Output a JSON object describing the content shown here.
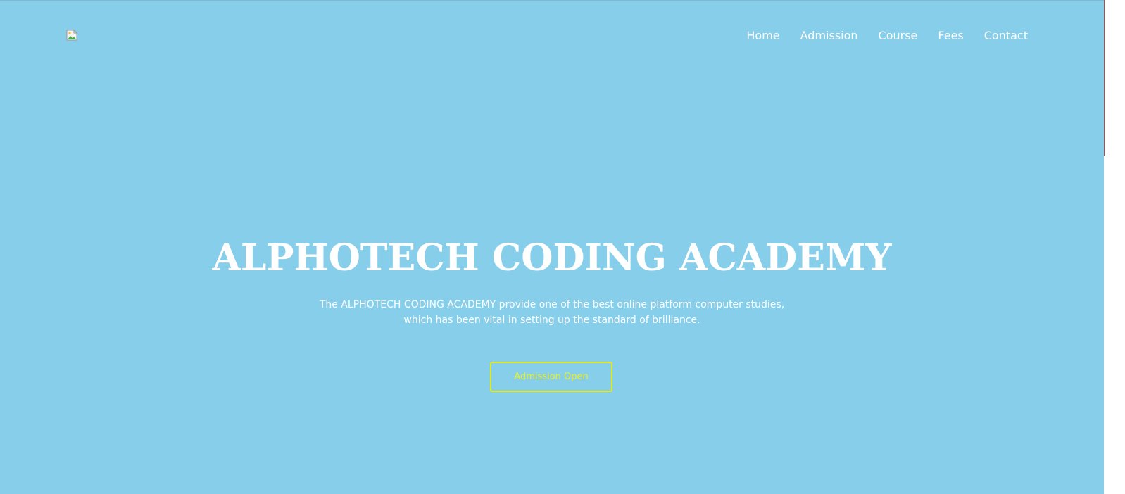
{
  "nav": {
    "items": [
      {
        "label": "Home"
      },
      {
        "label": "Admission"
      },
      {
        "label": "Course"
      },
      {
        "label": "Fees"
      },
      {
        "label": "Contact"
      }
    ]
  },
  "hero": {
    "title": "ALPHOTECH CODING ACADEMY",
    "subtitle": "The ALPHOTECH CODING ACADEMY provide one of the best online platform computer studies, which has been vital in setting up the standard of brilliance.",
    "cta_label": "Admission Open"
  },
  "logo": {
    "icon": "broken-image-icon"
  },
  "colors": {
    "background": "#87ceea",
    "text": "#ffffff",
    "accent": "#e0ea1e"
  }
}
